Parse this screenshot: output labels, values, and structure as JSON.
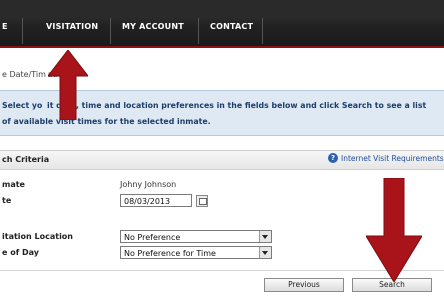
{
  "nav": {
    "items": [
      "E",
      "VISITATION",
      "MY ACCOUNT",
      "CONTACT"
    ]
  },
  "breadcrumb": "e Date/Tim ation",
  "instructions": {
    "line1": "Select yo   it date, time and location preferences in the fields below and click Search to see a list",
    "line2": "of available visit times for the selected inmate."
  },
  "criteria": {
    "title": "ch Criteria",
    "requirements_link": "Internet Visit Requirements",
    "inmate_label": "mate",
    "inmate_value": "Johny Johnson",
    "date_label": "te",
    "date_value": "08/03/2013",
    "location_label": "itation Location",
    "location_value": "No Preference",
    "time_label": "e of Day",
    "time_value": "No Preference for Time"
  },
  "buttons": {
    "previous": "Previous",
    "search": "Search"
  },
  "colors": {
    "arrow_red": "#a8141a",
    "nav_bg": "#222222",
    "instruction_bg": "#dfe9f4"
  }
}
